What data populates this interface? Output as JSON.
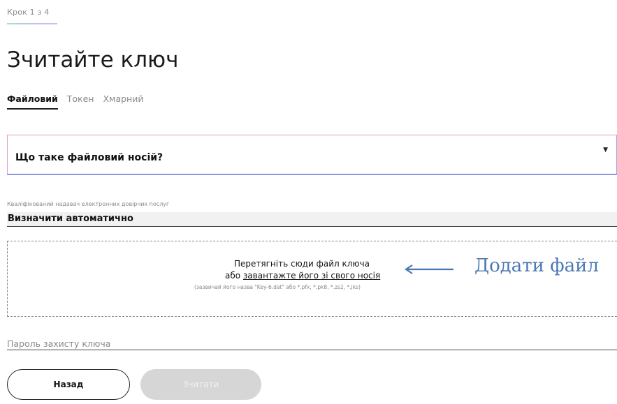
{
  "step": {
    "label": "Крок 1 з 4"
  },
  "page": {
    "title": "Зчитайте ключ"
  },
  "tabs": [
    {
      "label": "Файловий",
      "active": true
    },
    {
      "label": "Токен",
      "active": false
    },
    {
      "label": "Хмарний",
      "active": false
    }
  ],
  "faq": {
    "title": "Що таке файловий носій?",
    "icon": "chevron-down-icon"
  },
  "provider": {
    "label": "Кваліфікований надавач електронних довірчих послуг",
    "value": "Визначити автоматично"
  },
  "dropzone": {
    "line1": "Перетягніть сюди файл ключа",
    "line2_prefix": "або ",
    "line2_link": "завантажте його зі свого носія",
    "hint": "(зазвичай його назва \"Key-6.dat\" або *.pfx, *.pk8, *.zs2, *.jks)"
  },
  "annotation": {
    "text": "Додати файл",
    "color": "#4a77b4",
    "icon": "arrow-left-icon"
  },
  "password": {
    "placeholder": "Пароль захисту ключа",
    "value": ""
  },
  "buttons": {
    "back": "Назад",
    "read": "Зчитати",
    "read_disabled": true
  }
}
